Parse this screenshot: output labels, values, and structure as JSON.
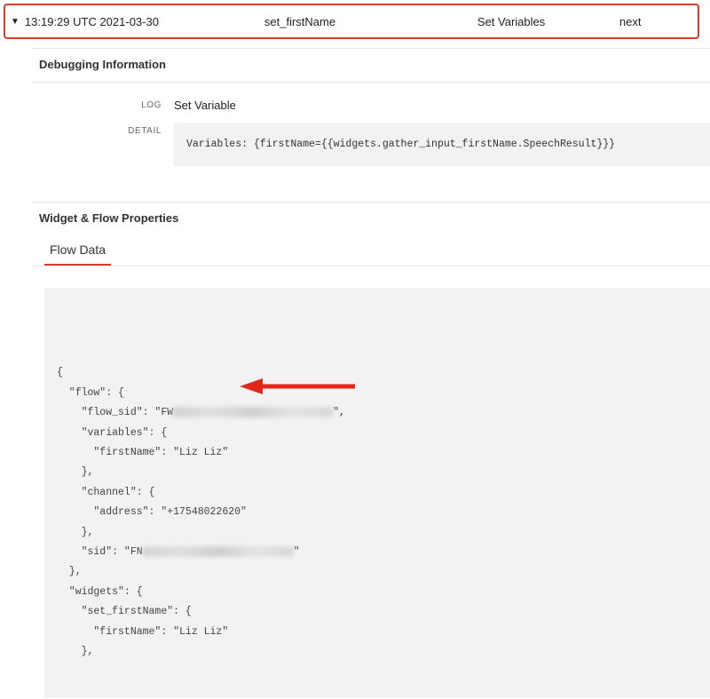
{
  "header": {
    "timestamp": "13:19:29 UTC 2021-03-30",
    "widget_name": "set_firstName",
    "step_type": "Set Variables",
    "transition": "next"
  },
  "debug": {
    "title": "Debugging Information",
    "log_label": "LOG",
    "log_value": "Set Variable",
    "detail_label": "DETAIL",
    "detail_code": "Variables: {firstName={{widgets.gather_input_firstName.SpeechResult}}}"
  },
  "wfp": {
    "title": "Widget & Flow Properties",
    "tab": "Flow Data"
  },
  "flow_data": {
    "lines": [
      "{",
      "  \"flow\": {",
      "    \"flow_sid\": \"FW[BLUR:180]\",",
      "    \"variables\": {",
      "      \"firstName\": \"Liz Liz\"",
      "    },",
      "    \"channel\": {",
      "      \"address\": \"+17548022620\"",
      "    },",
      "    \"sid\": \"FN[BLUR:170]\"",
      "  },",
      "  \"widgets\": {",
      "    \"set_firstName\": {",
      "      \"firstName\": \"Liz Liz\"",
      "    },"
    ]
  }
}
